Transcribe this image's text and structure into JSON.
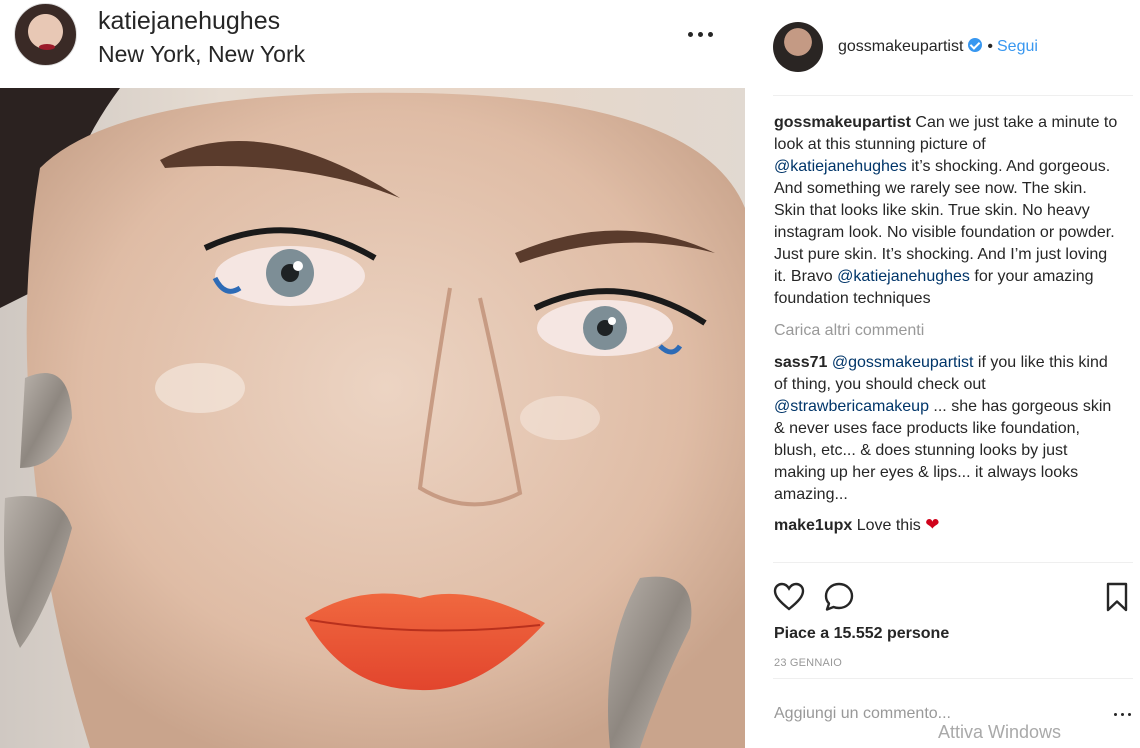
{
  "post_header": {
    "username": "katiejanehughes",
    "location": "New York, New York",
    "more_icon": "more-dots-icon"
  },
  "panel_header": {
    "username": "gossmakeupartist",
    "verified_icon": "verified-badge-icon",
    "separator": "•",
    "follow_label": "Segui"
  },
  "caption": {
    "user": "gossmakeupartist",
    "text_1": " Can we just take a minute to look at this stunning picture of ",
    "mention_1": "@katiejanehughes",
    "text_2": " it’s shocking. And gorgeous. And something we rarely see now. The skin. Skin that looks like skin. True skin. No heavy instagram look. No visible foundation or powder. Just pure skin. It’s shocking. And I’m just loving it. Bravo ",
    "mention_2": "@katiejanehughes",
    "text_3": " for your amazing foundation techniques"
  },
  "load_more_label": "Carica altri commenti",
  "comments": [
    {
      "user": "sass71",
      "mention_1": "@gossmakeupartist",
      "text_1": " if you like this kind of thing, you should check out ",
      "mention_2": "@strawbericamakeup",
      "text_2": " ... she has gorgeous skin & never uses face products like foundation, blush, etc... & does stunning looks by just making up her eyes & lips... it always looks amazing..."
    },
    {
      "user": "make1upx",
      "text": " Love this ",
      "emoji": "❤"
    }
  ],
  "actions": {
    "like_icon": "heart-icon",
    "comment_icon": "comment-bubble-icon",
    "save_icon": "bookmark-icon"
  },
  "likes_label": "Piace a 15.552 persone",
  "date_label": "23 GENNAIO",
  "add_comment_placeholder": "Aggiungi un commento...",
  "watermark": "Attiva Windows",
  "colors": {
    "link": "#3897f0",
    "mention": "#003569",
    "muted": "#999999",
    "text": "#262626"
  }
}
